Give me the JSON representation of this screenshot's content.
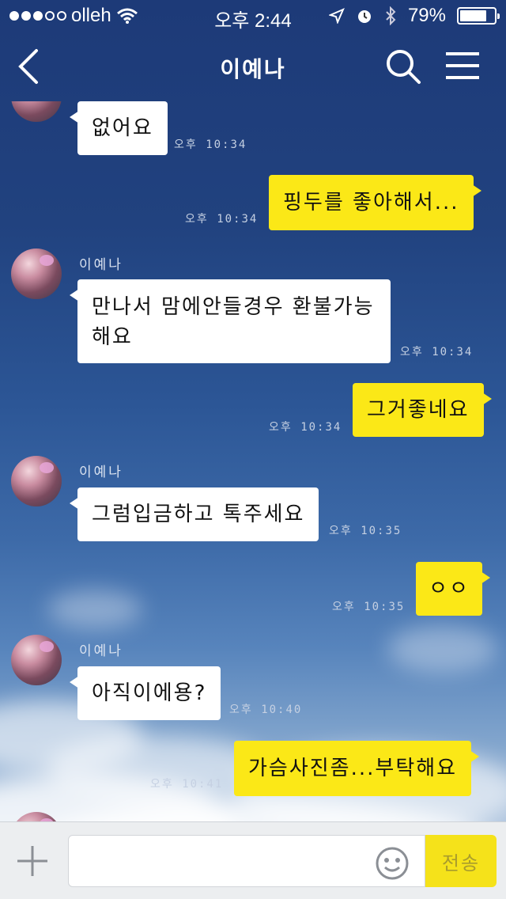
{
  "status_bar": {
    "carrier": "olleh",
    "time": "오후 2:44",
    "battery": "79%",
    "battery_level": 0.79
  },
  "header": {
    "title": "이예나"
  },
  "messages": [
    {
      "side": "in",
      "text": "없어요",
      "time": "오후 10:34"
    },
    {
      "side": "out",
      "text": "핑두를 좋아해서...",
      "time": "오후 10:34"
    },
    {
      "side": "in",
      "sender": "이예나",
      "line1": "만나서 맘에안들경우 환불가능",
      "line2": "해요",
      "time": "오후 10:34"
    },
    {
      "side": "out",
      "text": "그거좋네요",
      "time": "오후 10:34"
    },
    {
      "side": "in",
      "sender": "이예나",
      "text": "그럼입금하고 톡주세요",
      "time": "오후 10:35"
    },
    {
      "side": "out",
      "text": "ㅇㅇ",
      "time": "오후 10:35"
    },
    {
      "side": "in",
      "sender": "이예나",
      "text": "아직이에용?",
      "time": "오후 10:40"
    },
    {
      "side": "out",
      "text": "가슴사진좀...부탁해요",
      "time": "오후 10:41"
    }
  ],
  "input": {
    "send_label": "전송",
    "value": ""
  },
  "icons": [
    "back-icon",
    "search-icon",
    "menu-icon",
    "plus-icon",
    "emoji-icon",
    "wifi-icon",
    "location-icon",
    "alarm-icon",
    "bluetooth-icon"
  ]
}
